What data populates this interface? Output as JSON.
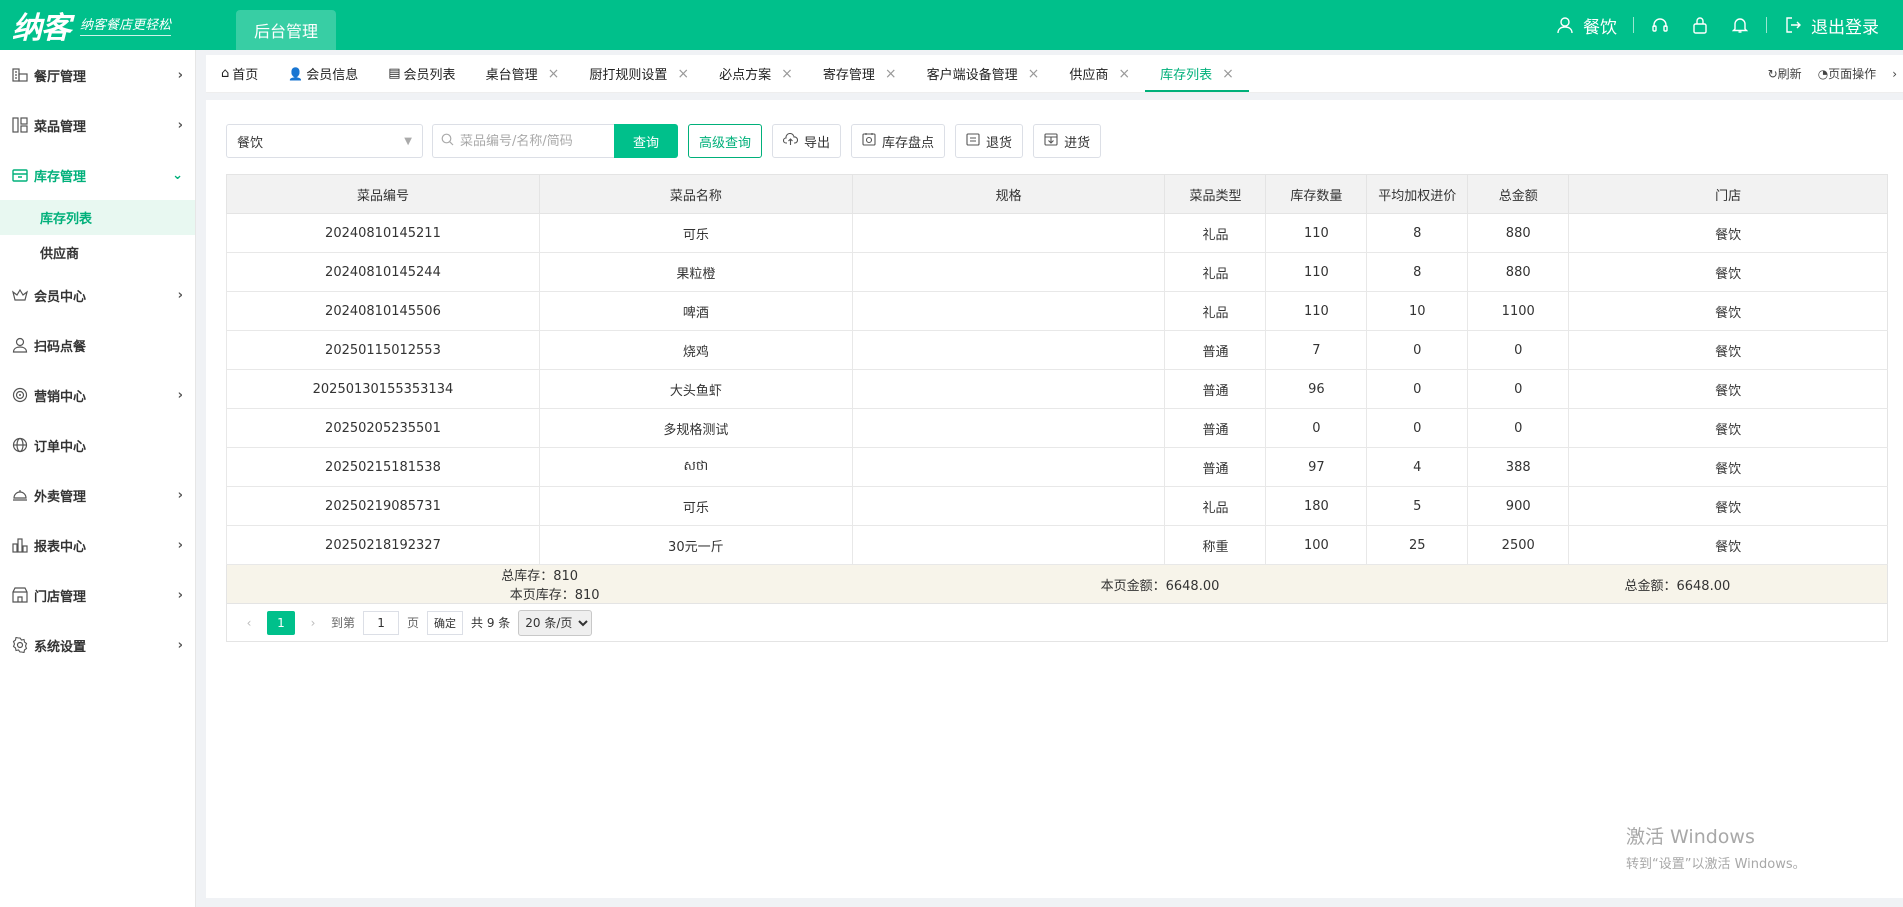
{
  "header": {
    "logo_text": "纳客",
    "slogan": "纳客餐店更轻松",
    "backend_tab": "后台管理",
    "user_name": "餐饮",
    "logout_label": "退出登录"
  },
  "sidebar": {
    "items": [
      {
        "label": "餐厅管理",
        "icon": "restaurant-icon",
        "arrow": "›"
      },
      {
        "label": "菜品管理",
        "icon": "dishes-icon",
        "arrow": "›"
      },
      {
        "label": "库存管理",
        "icon": "inventory-icon",
        "arrow": "⌄",
        "active": true,
        "children": [
          {
            "label": "库存列表",
            "active": true
          },
          {
            "label": "供应商"
          }
        ]
      },
      {
        "label": "会员中心",
        "icon": "crown-icon",
        "arrow": "›"
      },
      {
        "label": "扫码点餐",
        "icon": "user-icon",
        "arrow": ""
      },
      {
        "label": "营销中心",
        "icon": "target-icon",
        "arrow": "›"
      },
      {
        "label": "订单中心",
        "icon": "globe-icon",
        "arrow": ""
      },
      {
        "label": "外卖管理",
        "icon": "delivery-icon",
        "arrow": "›"
      },
      {
        "label": "报表中心",
        "icon": "report-icon",
        "arrow": "›"
      },
      {
        "label": "门店管理",
        "icon": "store-icon",
        "arrow": "›"
      },
      {
        "label": "系统设置",
        "icon": "gear-icon",
        "arrow": "›"
      }
    ]
  },
  "tabs": {
    "items": [
      {
        "label": "首页",
        "icon": "home-icon",
        "closable": false
      },
      {
        "label": "会员信息",
        "icon": "member-icon",
        "closable": false
      },
      {
        "label": "会员列表",
        "icon": "list-icon",
        "closable": false
      },
      {
        "label": "桌台管理",
        "closable": true
      },
      {
        "label": "厨打规则设置",
        "closable": true
      },
      {
        "label": "必点方案",
        "closable": true
      },
      {
        "label": "寄存管理",
        "closable": true
      },
      {
        "label": "客户端设备管理",
        "closable": true
      },
      {
        "label": "供应商",
        "closable": true
      },
      {
        "label": "库存列表",
        "closable": true,
        "active": true
      }
    ],
    "refresh_label": "刷新",
    "page_ops_label": "页面操作"
  },
  "toolbar": {
    "store_select": "餐饮",
    "search_placeholder": "菜品编号/名称/简码",
    "query_label": "查询",
    "advanced_label": "高级查询",
    "export_label": "导出",
    "stocktake_label": "库存盘点",
    "return_label": "退货",
    "purchase_label": "进货"
  },
  "table": {
    "columns": [
      "菜品编号",
      "菜品名称",
      "规格",
      "菜品类型",
      "库存数量",
      "平均加权进价",
      "总金额",
      "门店"
    ],
    "rows": [
      [
        "20240810145211",
        "可乐",
        "",
        "礼品",
        "110",
        "8",
        "880",
        "餐饮"
      ],
      [
        "20240810145244",
        "果粒橙",
        "",
        "礼品",
        "110",
        "8",
        "880",
        "餐饮"
      ],
      [
        "20240810145506",
        "啤酒",
        "",
        "礼品",
        "110",
        "10",
        "1100",
        "餐饮"
      ],
      [
        "20250115012553",
        "烧鸡",
        "",
        "普通",
        "7",
        "0",
        "0",
        "餐饮"
      ],
      [
        "20250130155353134",
        "大头鱼虾",
        "",
        "普通",
        "96",
        "0",
        "0",
        "餐饮"
      ],
      [
        "20250205235501",
        "多规格测试",
        "",
        "普通",
        "0",
        "0",
        "0",
        "餐饮"
      ],
      [
        "20250215181538",
        "សថា",
        "",
        "普通",
        "97",
        "4",
        "388",
        "餐饮"
      ],
      [
        "20250219085731",
        "可乐",
        "",
        "礼品",
        "180",
        "5",
        "900",
        "餐饮"
      ],
      [
        "20250218192327",
        "30元一斤",
        "",
        "称重",
        "100",
        "25",
        "2500",
        "餐饮"
      ]
    ],
    "summary": {
      "total_stock": "总库存：810",
      "page_stock": "本页库存：810",
      "page_amount": "本页金额：6648.00",
      "total_amount": "总金额：6648.00"
    }
  },
  "pagination": {
    "prev": "‹",
    "current_page": "1",
    "next": "›",
    "goto_label": "到第",
    "goto_value": "1",
    "page_unit": "页",
    "confirm_label": "确定",
    "total_label": "共 9 条",
    "page_size": "20 条/页"
  },
  "watermark": {
    "line1": "激活 Windows",
    "line2": "转到“设置”以激活 Windows。"
  },
  "colors": {
    "brand": "#00c08b",
    "active_text": "#00b07a",
    "summary_bg": "#f7f4ea"
  }
}
